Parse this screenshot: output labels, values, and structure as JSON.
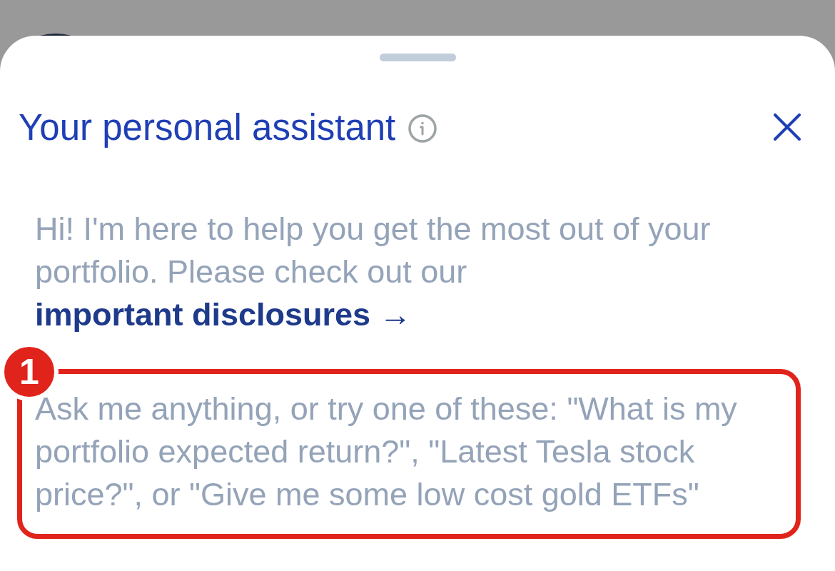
{
  "sheet": {
    "title": "Your personal assistant",
    "intro": {
      "text": "Hi! I'm here to help you get the most out of your portfolio. Please check out our",
      "link": "important disclosures →"
    },
    "composer": {
      "placeholder": "Ask me anything, or try one of these: \"What is my portfolio expected return?\", \"Latest Tesla stock price?\", or \"Give me some low cost gold ETFs\""
    },
    "annotation": {
      "label": "1"
    }
  }
}
